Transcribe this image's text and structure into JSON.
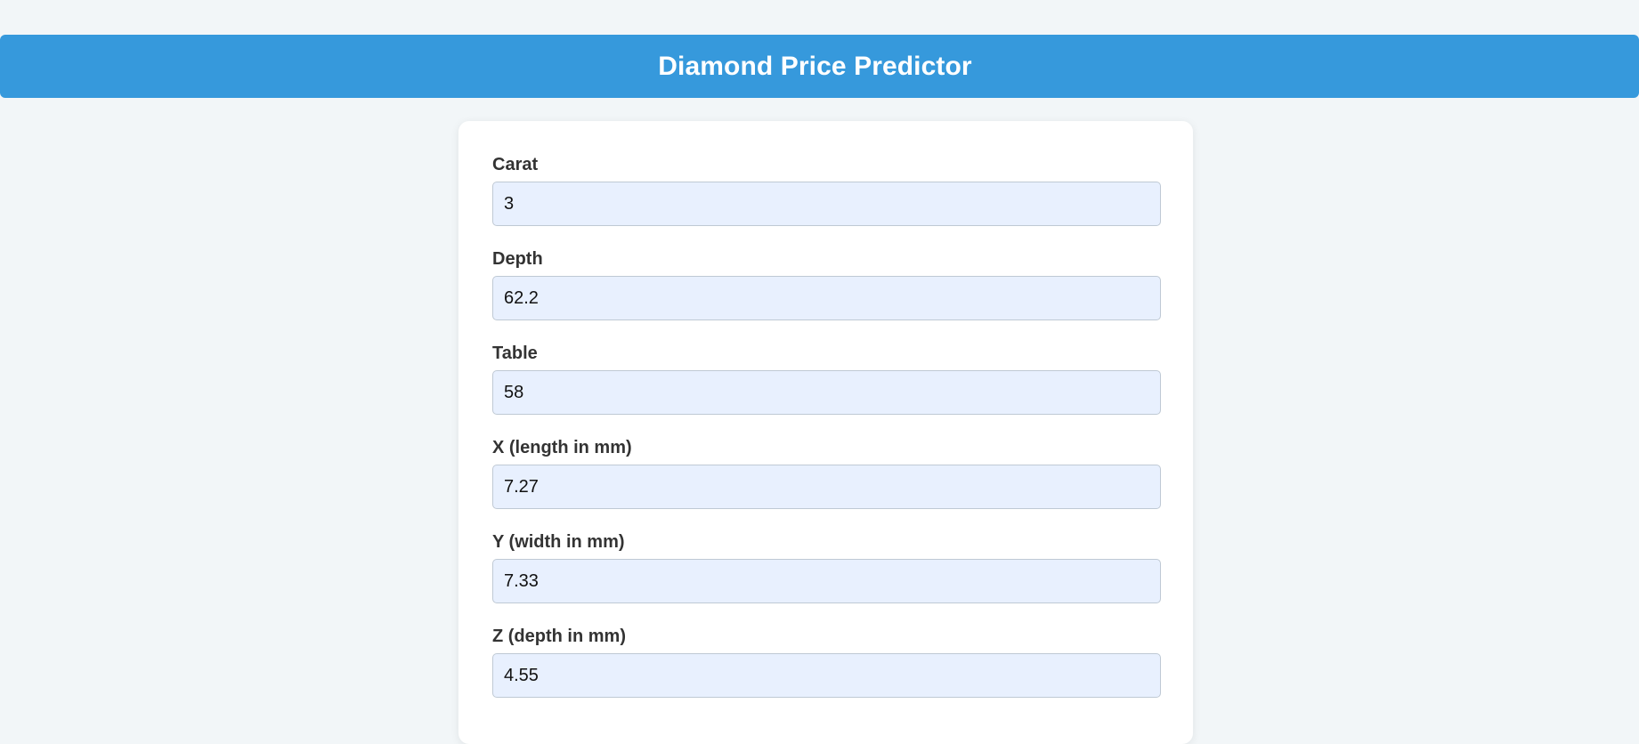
{
  "header": {
    "title": "Diamond Price Predictor"
  },
  "form": {
    "fields": [
      {
        "id": "carat",
        "label": "Carat",
        "value": "3"
      },
      {
        "id": "depth",
        "label": "Depth",
        "value": "62.2"
      },
      {
        "id": "table",
        "label": "Table",
        "value": "58"
      },
      {
        "id": "x",
        "label": "X (length in mm)",
        "value": "7.27"
      },
      {
        "id": "y",
        "label": "Y (width in mm)",
        "value": "7.33"
      },
      {
        "id": "z",
        "label": "Z (depth in mm)",
        "value": "4.55"
      }
    ]
  },
  "colors": {
    "background": "#f2f6f8",
    "header": "#3699dc",
    "input_background": "#e8f0fe",
    "card": "#ffffff"
  }
}
